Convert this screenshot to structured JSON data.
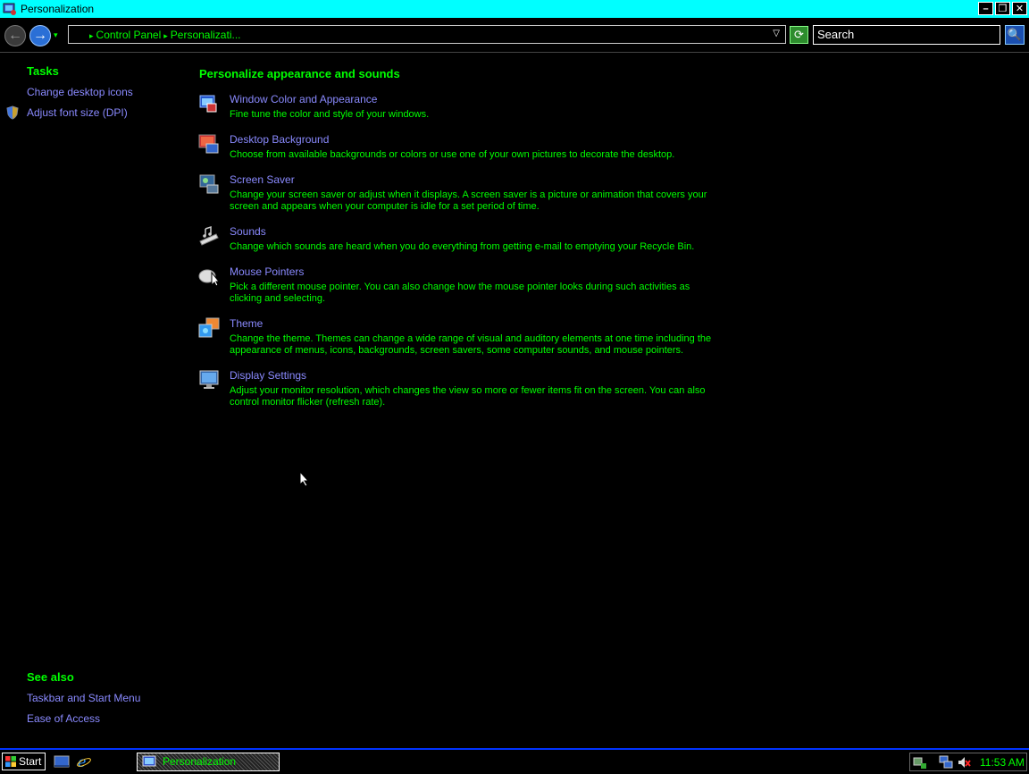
{
  "window": {
    "title": "Personalization",
    "min_label": "–",
    "max_label": "❐",
    "close_label": "✕"
  },
  "toolbar": {
    "back_glyph": "←",
    "forward_glyph": "→",
    "nav_dropdown_glyph": "▾",
    "breadcrumb_root_sep": "▸",
    "breadcrumb": [
      "Control Panel",
      "Personalizati..."
    ],
    "address_dropdown_glyph": "▽",
    "refresh_glyph": "⟳",
    "search_placeholder": "Search",
    "search_glyph": "🔍"
  },
  "left_pane": {
    "tasks_heading": "Tasks",
    "tasks": [
      "Change desktop icons",
      "Adjust font size (DPI)"
    ],
    "see_also_heading": "See also",
    "see_also": [
      "Taskbar and Start Menu",
      "Ease of Access"
    ]
  },
  "main": {
    "heading": "Personalize appearance and sounds",
    "items": [
      {
        "title": "Window Color and Appearance",
        "desc": "Fine tune the color and style of your windows.",
        "icon": "window-color-icon"
      },
      {
        "title": "Desktop Background",
        "desc": "Choose from available backgrounds or colors or use one of your own pictures to decorate the desktop.",
        "icon": "desktop-background-icon"
      },
      {
        "title": "Screen Saver",
        "desc": "Change your screen saver or adjust when it displays. A screen saver is a picture or animation that covers your screen and appears when your computer is idle for a set period of time.",
        "icon": "screen-saver-icon"
      },
      {
        "title": "Sounds",
        "desc": "Change which sounds are heard when you do everything from getting e-mail to emptying your Recycle Bin.",
        "icon": "sounds-icon"
      },
      {
        "title": "Mouse Pointers",
        "desc": "Pick a different mouse pointer. You can also change how the mouse pointer looks during such activities as clicking and selecting.",
        "icon": "mouse-pointers-icon"
      },
      {
        "title": "Theme",
        "desc": "Change the theme. Themes can change a wide range of visual and auditory elements at one time including the appearance of menus, icons, backgrounds, screen savers, some computer sounds, and mouse pointers.",
        "icon": "theme-icon"
      },
      {
        "title": "Display Settings",
        "desc": "Adjust your monitor resolution, which changes the view so more or fewer items fit on the screen. You can also control monitor flicker (refresh rate).",
        "icon": "display-settings-icon"
      }
    ]
  },
  "taskbar": {
    "start_label": "Start",
    "task_label": "Personalization",
    "clock": "11:53 AM"
  },
  "colors": {
    "title_bar": "#00ffff",
    "heading_text": "#00ff00",
    "link_text": "#8a8aff",
    "background": "#000000",
    "taskbar_border": "#0033ff"
  }
}
